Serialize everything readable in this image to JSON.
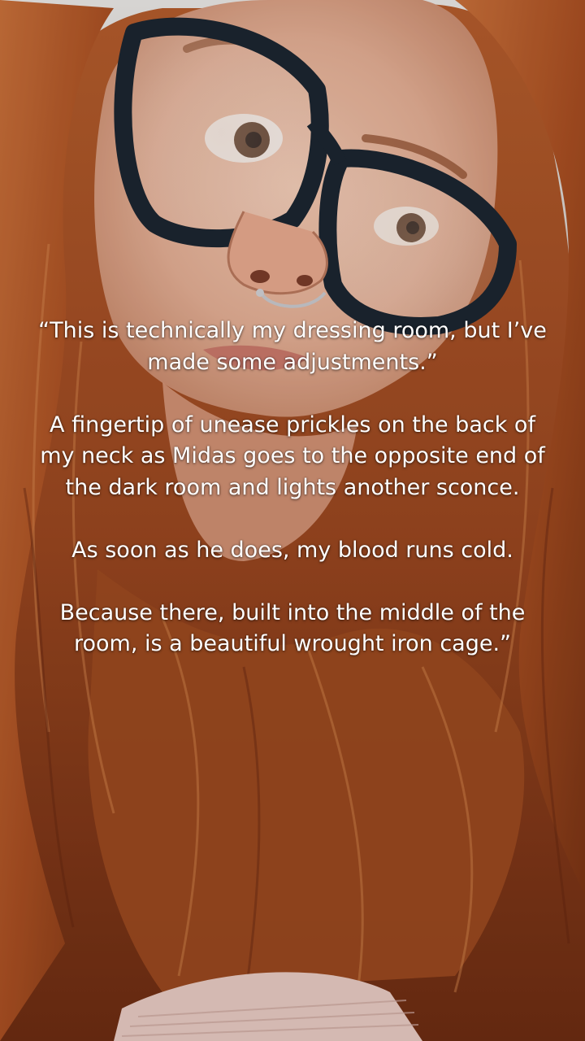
{
  "video": {
    "caption_paragraphs": [
      "“This is technically my dressing room, but I’ve made some adjustments.”",
      "A fingertip of unease prickles on the back of my neck as Midas goes to the opposite end of the dark room and lights another sconce.",
      "As soon as he does, my blood runs cold.",
      "Because there, built into the middle of the room, is a beautiful wrought iron cage.”"
    ]
  },
  "colors": {
    "caption_text": "#ffffff",
    "hair": "#b25a2a",
    "skin": "#e3b39b",
    "glasses_frame": "#1c2530",
    "wall": "#dcd6d2"
  }
}
